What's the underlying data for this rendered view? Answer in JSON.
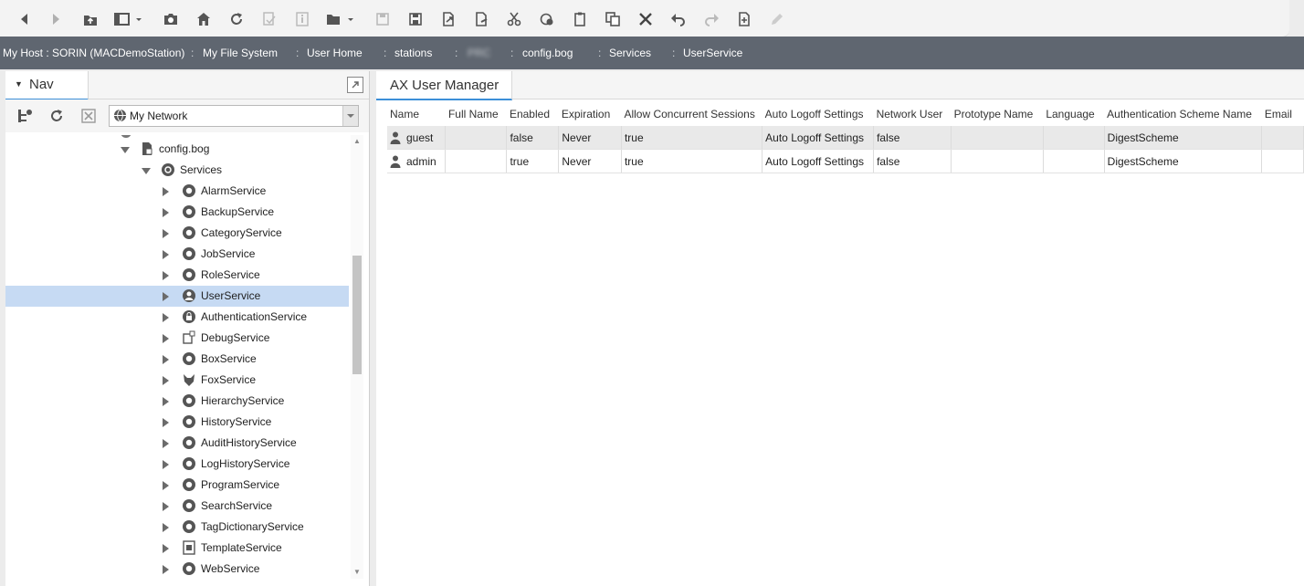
{
  "toolbar": {
    "buttons": [
      "back-icon",
      "forward-icon",
      "up-level-icon",
      "side-bar-icon",
      "snapshot-icon",
      "home-icon",
      "refresh-icon",
      "disabled-icon",
      "info-icon",
      "open-folder-icon",
      "save-icon",
      "save-all-icon",
      "export-icon",
      "import-icon",
      "cut-icon",
      "copy-icon",
      "paste-icon",
      "duplicate-icon",
      "delete-icon",
      "undo-icon",
      "redo-icon",
      "new-file-icon",
      "edit-icon"
    ]
  },
  "locator": {
    "crumbs": [
      "My Host : SORIN (MACDemoStation)",
      "My File System",
      "User Home",
      "stations",
      "PRC",
      "config.bog",
      "Services",
      "UserService"
    ]
  },
  "nav": {
    "title": "Nav",
    "network_select": "My Network",
    "tree": [
      {
        "label": "config.bog",
        "icon": "bog-file-icon",
        "level": 1,
        "open": true
      },
      {
        "label": "Services",
        "icon": "services-icon",
        "level": 2,
        "open": true
      },
      {
        "label": "AlarmService",
        "icon": "alarm-icon",
        "level": 3
      },
      {
        "label": "BackupService",
        "icon": "backup-icon",
        "level": 3
      },
      {
        "label": "CategoryService",
        "icon": "category-icon",
        "level": 3
      },
      {
        "label": "JobService",
        "icon": "job-icon",
        "level": 3
      },
      {
        "label": "RoleService",
        "icon": "role-icon",
        "level": 3
      },
      {
        "label": "UserService",
        "icon": "user-icon",
        "level": 3,
        "selected": true
      },
      {
        "label": "AuthenticationService",
        "icon": "lock-icon",
        "level": 3
      },
      {
        "label": "DebugService",
        "icon": "debug-icon",
        "level": 3
      },
      {
        "label": "BoxService",
        "icon": "box-icon",
        "level": 3
      },
      {
        "label": "FoxService",
        "icon": "fox-icon",
        "level": 3
      },
      {
        "label": "HierarchyService",
        "icon": "hierarchy-icon",
        "level": 3
      },
      {
        "label": "HistoryService",
        "icon": "history-icon",
        "level": 3
      },
      {
        "label": "AuditHistoryService",
        "icon": "audit-icon",
        "level": 3
      },
      {
        "label": "LogHistoryService",
        "icon": "log-icon",
        "level": 3
      },
      {
        "label": "ProgramService",
        "icon": "program-icon",
        "level": 3
      },
      {
        "label": "SearchService",
        "icon": "search-icon",
        "level": 3
      },
      {
        "label": "TagDictionaryService",
        "icon": "tag-icon",
        "level": 3
      },
      {
        "label": "TemplateService",
        "icon": "template-icon",
        "level": 3
      },
      {
        "label": "WebService",
        "icon": "web-icon",
        "level": 3
      }
    ]
  },
  "main": {
    "title": "AX User Manager",
    "columns": [
      "Name",
      "Full Name",
      "Enabled",
      "Expiration",
      "Allow Concurrent Sessions",
      "Auto Logoff Settings",
      "Network User",
      "Prototype Name",
      "Language",
      "Authentication Scheme Name",
      "Email"
    ],
    "rows": [
      [
        "guest",
        "",
        "false",
        "Never",
        "true",
        "Auto Logoff Settings",
        "false",
        "",
        "",
        "DigestScheme",
        ""
      ],
      [
        "admin",
        "",
        "true",
        "Never",
        "true",
        "Auto Logoff Settings",
        "false",
        "",
        "",
        "DigestScheme",
        ""
      ]
    ]
  },
  "colors": {
    "locator_bg": "#5f6670",
    "selection": "#c6daf3",
    "tab_accent": "#3c8fd8"
  }
}
